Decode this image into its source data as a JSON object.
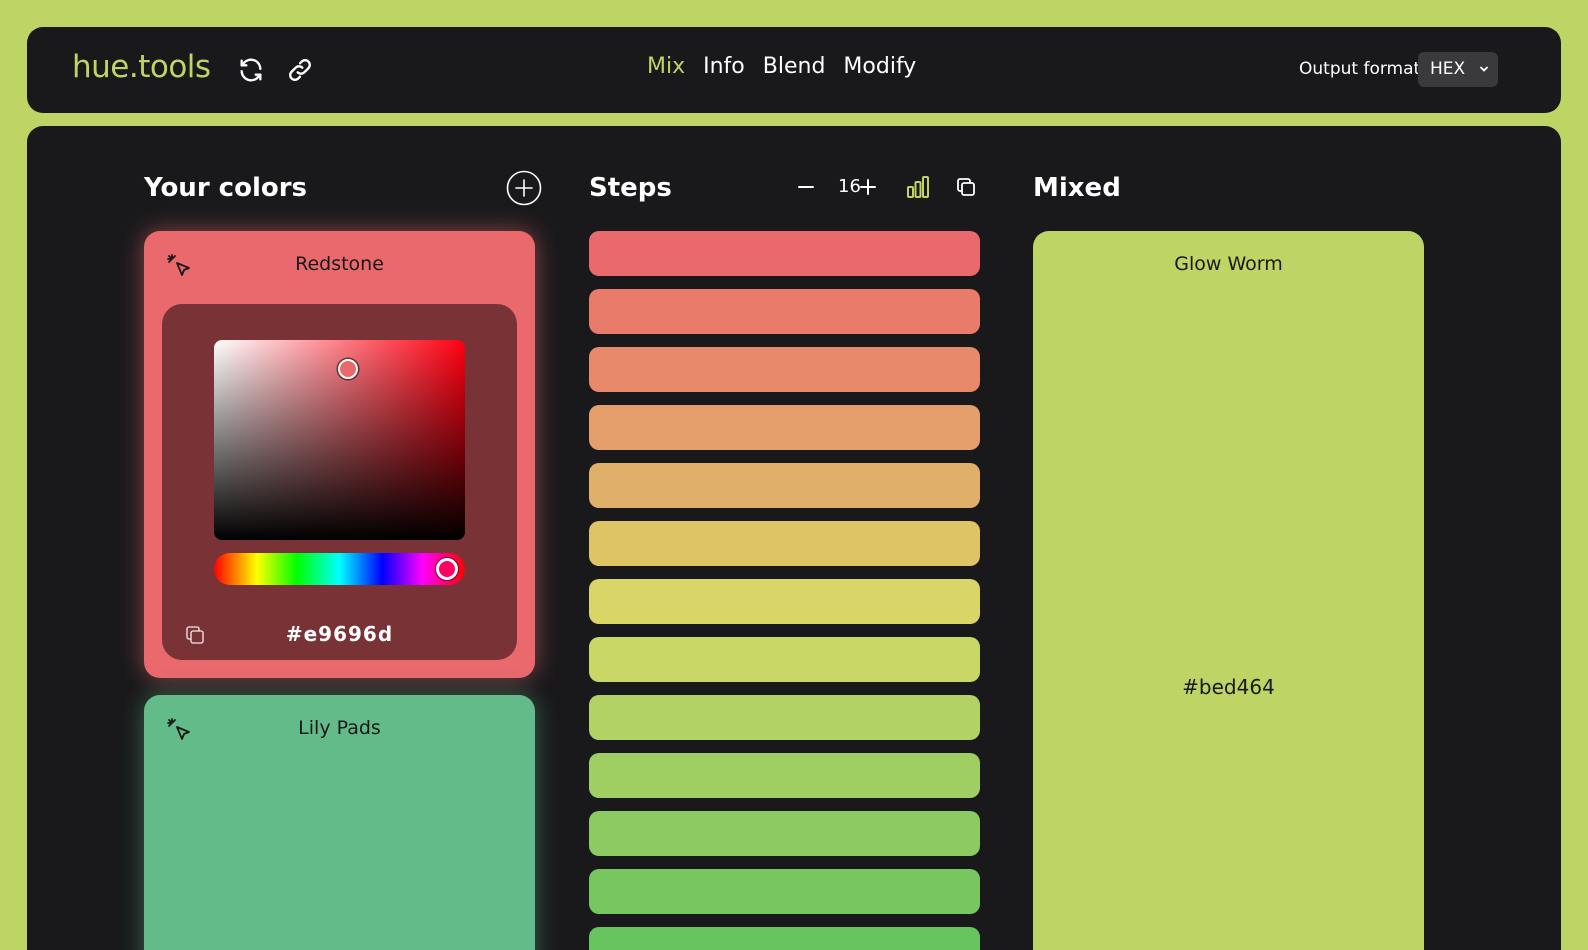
{
  "header": {
    "logo": "hue.tools",
    "nav": [
      {
        "label": "Mix",
        "active": true
      },
      {
        "label": "Info",
        "active": false
      },
      {
        "label": "Blend",
        "active": false
      },
      {
        "label": "Modify",
        "active": false
      }
    ],
    "output_label": "Output format:",
    "output_value": "HEX"
  },
  "your_colors": {
    "title": "Your colors",
    "colors": [
      {
        "name": "Redstone",
        "hex": "#e9696d",
        "color": "#e9696d"
      },
      {
        "name": "Lily Pads",
        "hex": "#62bb88",
        "color": "#62bb88"
      }
    ]
  },
  "steps": {
    "title": "Steps",
    "count": "16",
    "colors": [
      "#e9696d",
      "#e97b6b",
      "#e8896b",
      "#e49f6c",
      "#e0b06a",
      "#dfc466",
      "#d9d566",
      "#c9d766",
      "#b3d265",
      "#9fce63",
      "#8ccb62",
      "#78c660",
      "#68c45f"
    ]
  },
  "mixed": {
    "title": "Mixed",
    "name": "Glow Worm",
    "hex": "#bed464",
    "color": "#bed464"
  },
  "icons": {
    "refresh": "refresh-icon",
    "link": "link-icon",
    "add": "plus-circle-icon",
    "minus": "minus-icon",
    "plus": "plus-icon",
    "chart": "bar-chart-icon",
    "copy": "copy-icon",
    "pick": "cursor-pick-icon",
    "chevron": "chevron-down-icon"
  },
  "accent": "#bed464",
  "dark": "#19191b"
}
